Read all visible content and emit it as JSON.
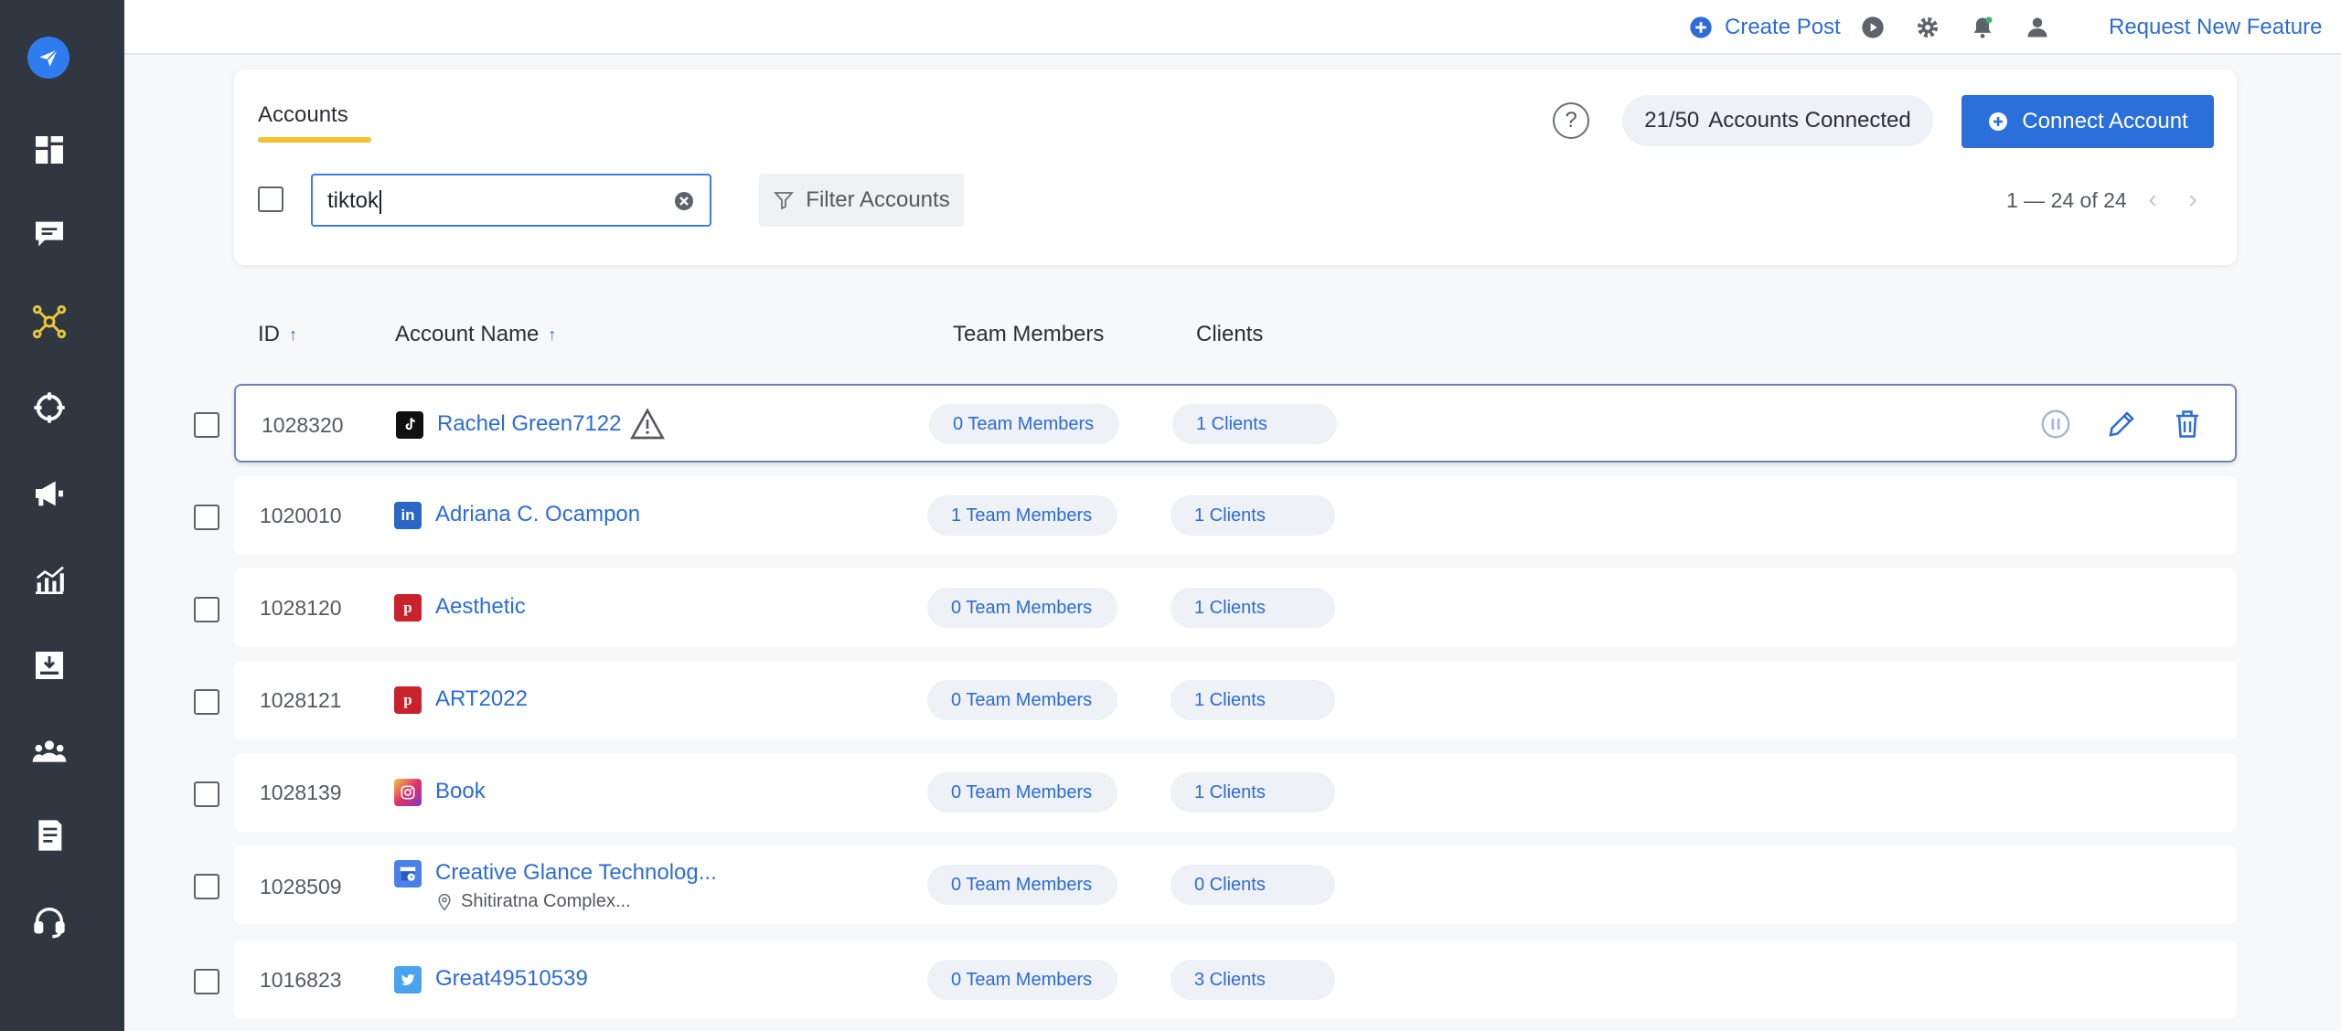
{
  "sidebar": {
    "items": [
      {
        "icon": "send-logo-icon"
      },
      {
        "icon": "dashboard-icon"
      },
      {
        "icon": "chat-icon"
      },
      {
        "icon": "network-icon",
        "active": true
      },
      {
        "icon": "compass-icon"
      },
      {
        "icon": "megaphone-icon"
      },
      {
        "icon": "analytics-icon"
      },
      {
        "icon": "inbox-icon"
      },
      {
        "icon": "team-icon"
      },
      {
        "icon": "report-icon"
      },
      {
        "icon": "support-icon"
      }
    ]
  },
  "header": {
    "create_post": "Create Post",
    "request_feature": "Request New Feature"
  },
  "accounts_panel": {
    "tab_label": "Accounts",
    "help": "?",
    "connected_count": "21/50",
    "connected_label": "Accounts Connected",
    "connect_button": "Connect Account",
    "search_value": "tiktok",
    "filter_label": "Filter Accounts",
    "pagination": "1 — 24 of 24"
  },
  "table": {
    "columns": {
      "id": "ID",
      "name": "Account Name",
      "team": "Team Members",
      "clients": "Clients"
    },
    "rows": [
      {
        "id": "1028320",
        "network": "tiktok",
        "name": "Rachel Green7122",
        "team": "0 Team Members",
        "clients": "1 Clients",
        "warning": true
      },
      {
        "id": "1020010",
        "network": "linkedin",
        "name": "Adriana C. Ocampon",
        "team": "1 Team Members",
        "clients": "1 Clients"
      },
      {
        "id": "1028120",
        "network": "pinterest",
        "name": "Aesthetic",
        "team": "0 Team Members",
        "clients": "1 Clients"
      },
      {
        "id": "1028121",
        "network": "pinterest",
        "name": "ART2022",
        "team": "0 Team Members",
        "clients": "1 Clients"
      },
      {
        "id": "1028139",
        "network": "instagram",
        "name": "Book",
        "team": "0 Team Members",
        "clients": "1 Clients"
      },
      {
        "id": "1028509",
        "network": "google-business",
        "name": "Creative Glance Technolog...",
        "location": "Shitiratna Complex...",
        "team": "0 Team Members",
        "clients": "0 Clients"
      },
      {
        "id": "1016823",
        "network": "twitter",
        "name": "Great49510539",
        "team": "0 Team Members",
        "clients": "3 Clients"
      }
    ]
  },
  "colors": {
    "sidebar_bg": "#303740",
    "accent": "#2b6fdb",
    "tab_underline": "#f2c232",
    "active_nav": "#e8c53a"
  }
}
